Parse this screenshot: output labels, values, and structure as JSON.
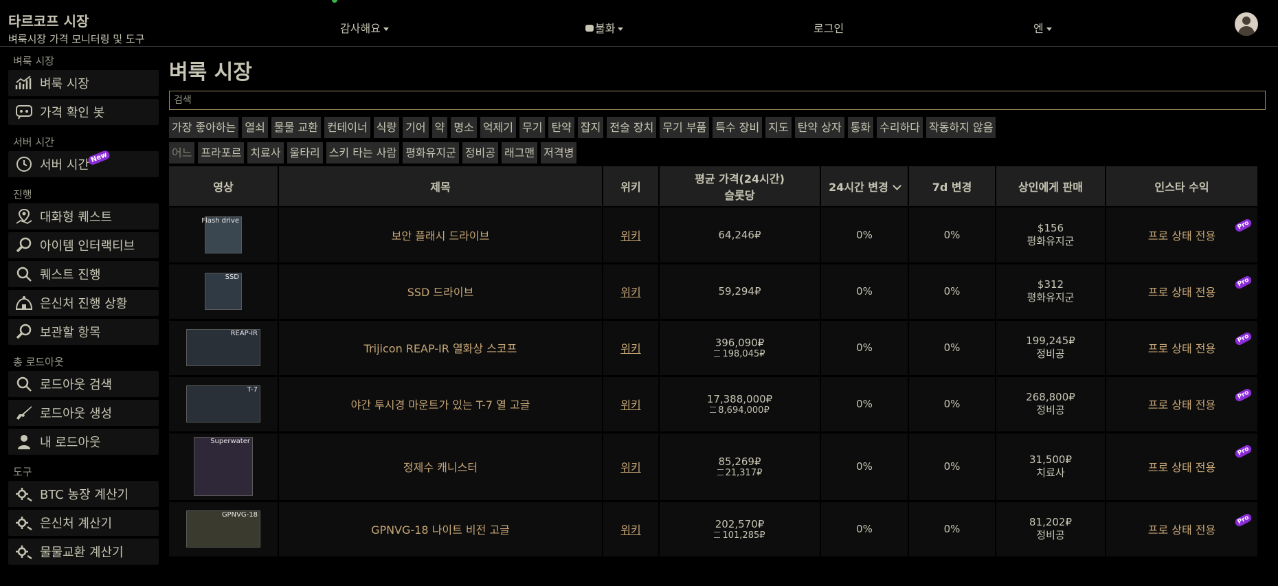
{
  "header": {
    "brand_title": "타르코프 시장",
    "brand_subtitle": "벼룩시장 가격 모니터링 및 도구",
    "menu": {
      "thanks": "감사해요",
      "discord": "불화",
      "login": "로그인",
      "currency": "엔"
    }
  },
  "sidebar": {
    "groups": [
      {
        "title": "벼룩 시장",
        "items": [
          {
            "label": "벼룩 시장",
            "icon": "chart-icon"
          },
          {
            "label": "가격 확인 봇",
            "icon": "discord-icon"
          }
        ]
      },
      {
        "title": "서버 시간",
        "items": [
          {
            "label": "서버 시간",
            "icon": "clock-icon",
            "badge": "New"
          }
        ]
      },
      {
        "title": "진행",
        "items": [
          {
            "label": "대화형 퀘스트",
            "icon": "map-pin-icon"
          },
          {
            "label": "아이템 인터랙티브",
            "icon": "magnifier-icon"
          },
          {
            "label": "퀘스트 진행",
            "icon": "search-icon"
          },
          {
            "label": "은신처 진행 상황",
            "icon": "hideout-icon"
          },
          {
            "label": "보관할 항목",
            "icon": "magnifier-icon"
          }
        ]
      },
      {
        "title": "총 로드아웃",
        "items": [
          {
            "label": "로드아웃 검색",
            "icon": "search-icon"
          },
          {
            "label": "로드아웃 생성",
            "icon": "rifle-icon"
          },
          {
            "label": "내 로드아웃",
            "icon": "user-icon"
          }
        ]
      },
      {
        "title": "도구",
        "items": [
          {
            "label": "BTC 농장 계산기",
            "icon": "calculator-icon"
          },
          {
            "label": "은신처 계산기",
            "icon": "calculator-icon"
          },
          {
            "label": "물물교환 계산기",
            "icon": "calculator-icon"
          }
        ]
      }
    ]
  },
  "main": {
    "title": "벼룩 시장",
    "search_placeholder": "검색",
    "filter_rows": [
      [
        "가장 좋아하는",
        "열쇠",
        "물물 교환",
        "컨테이너",
        "식량",
        "기어",
        "약",
        "명소",
        "억제기",
        "무기",
        "탄약",
        "잡지",
        "전술 장치",
        "무기 부품",
        "특수 장비",
        "지도",
        "탄약 상자",
        "통화",
        "수리하다",
        "작동하지 않음"
      ],
      [
        "어느",
        "프라포르",
        "치료사",
        "울타리",
        "스키 타는 사람",
        "평화유지군",
        "정비공",
        "래그맨",
        "저격병"
      ]
    ]
  },
  "table": {
    "headers": {
      "image": "영상",
      "name": "제목",
      "wiki": "위키",
      "avg_price": "평균 가격(24시간)",
      "avg_price_sub": "슬롯당",
      "change_24h": "24시간 변경",
      "change_7d": "7d 변경",
      "sell_trader": "상인에게 판매",
      "insta_profit": "인스타 수익"
    },
    "rows": [
      {
        "thumb_label": "Flash drive",
        "name": "보안 플래시 드라이브",
        "wiki": "위키",
        "avg_price": "64,246₽",
        "per_slot": "",
        "change_24h": "0%",
        "change_7d": "0%",
        "trader_price": "$156",
        "trader_name": "평화유지군",
        "profit": "프로 상태 전용",
        "pro_badge": "Pro"
      },
      {
        "thumb_label": "SSD",
        "name": "SSD 드라이브",
        "wiki": "위키",
        "avg_price": "59,294₽",
        "per_slot": "",
        "change_24h": "0%",
        "change_7d": "0%",
        "trader_price": "$312",
        "trader_name": "평화유지군",
        "profit": "프로 상태 전용",
        "pro_badge": "Pro"
      },
      {
        "thumb_label": "REAP-IR",
        "name": "Trijicon REAP-IR 열화상 스코프",
        "wiki": "위키",
        "avg_price": "396,090₽",
        "per_slot": "198,045₽",
        "change_24h": "0%",
        "change_7d": "0%",
        "trader_price": "199,245₽",
        "trader_name": "정비공",
        "profit": "프로 상태 전용",
        "pro_badge": "Pro"
      },
      {
        "thumb_label": "T-7",
        "name": "야간 투시경 마운트가 있는 T-7 열 고글",
        "wiki": "위키",
        "avg_price": "17,388,000₽",
        "per_slot": "8,694,000₽",
        "change_24h": "0%",
        "change_7d": "0%",
        "trader_price": "268,800₽",
        "trader_name": "정비공",
        "profit": "프로 상태 전용",
        "pro_badge": "Pro"
      },
      {
        "thumb_label": "Superwater",
        "name": "정제수 캐니스터",
        "wiki": "위키",
        "avg_price": "85,269₽",
        "per_slot": "21,317₽",
        "change_24h": "0%",
        "change_7d": "0%",
        "trader_price": "31,500₽",
        "trader_name": "치료사",
        "profit": "프로 상태 전용",
        "pro_badge": "Pro"
      },
      {
        "thumb_label": "GPNVG-18",
        "name": "GPNVG-18 나이트 비전 고글",
        "wiki": "위키",
        "avg_price": "202,570₽",
        "per_slot": "101,285₽",
        "change_24h": "0%",
        "change_7d": "0%",
        "trader_price": "81,202₽",
        "trader_name": "정비공",
        "profit": "프로 상태 전용",
        "pro_badge": "Pro"
      }
    ]
  },
  "colors": {
    "accent_text": "#c7a777",
    "pro_badge": "#8b2dd6",
    "header_cell": "#202020",
    "row_cell": "#0d0d0d"
  }
}
